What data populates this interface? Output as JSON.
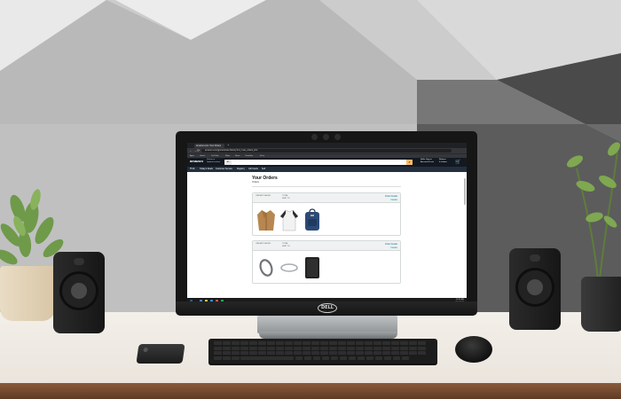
{
  "browser": {
    "tab_title": "Amazon.com: Your Orders",
    "new_tab_glyph": "+",
    "back_glyph": "←",
    "forward_glyph": "→",
    "reload_glyph": "⟳",
    "url": "amazon.com/gp/css/order-history?ref_=nav_orders_first",
    "bookmarks": [
      "Apps",
      "Gmail",
      "YouTube",
      "Maps",
      "News",
      "Translate",
      "Drive"
    ]
  },
  "amazon": {
    "logo_text": "amazon",
    "deliver_line1": "Deliver to",
    "deliver_line2": "Update location",
    "search_category": "All",
    "search_button_glyph": "⌕",
    "account_line1": "Hello, Sign in",
    "account_line2": "Account & Lists",
    "returns_line1": "Returns",
    "returns_line2": "& Orders",
    "cart_glyph": "🛒",
    "nav_items": [
      "☰ All",
      "Today's Deals",
      "Customer Service",
      "Registry",
      "Gift Cards",
      "Sell"
    ]
  },
  "page": {
    "title": "Your Orders",
    "filter_text": "Orders"
  },
  "orders": [
    {
      "placed_label": "Order placed",
      "total_label": "Total",
      "ship_label": "Ship to",
      "details_link": "Order Details",
      "invoice_link": "Invoice",
      "items": [
        "jacket",
        "raglan-shirt",
        "backpack"
      ]
    },
    {
      "placed_label": "Order placed",
      "total_label": "Total",
      "ship_label": "Ship to",
      "details_link": "Order Details",
      "invoice_link": "Invoice",
      "items": [
        "bracelet",
        "bangle",
        "tablet-case"
      ]
    }
  ],
  "taskbar": {
    "start_glyph": "⊞",
    "time": "10:24 AM",
    "date": "3/14/2022"
  },
  "device": {
    "brand": "DELL"
  },
  "colors": {
    "amazon_dark": "#131921",
    "amazon_nav": "#232f3e",
    "amazon_orange": "#febd69",
    "link_teal": "#007185",
    "backpack_navy": "#2c4a78",
    "jacket_tan": "#b8864f"
  }
}
